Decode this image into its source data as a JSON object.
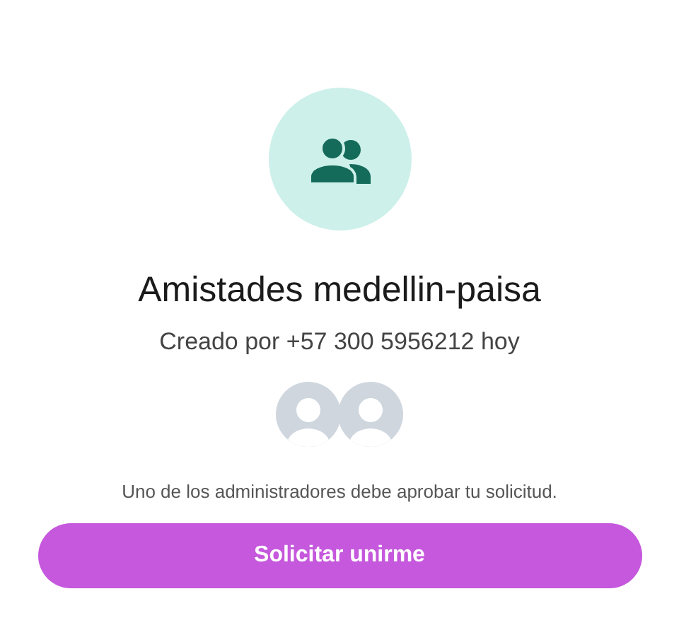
{
  "group": {
    "name": "Amistades medellin-paisa",
    "created": "Creado por +57 300 5956212 hoy"
  },
  "member_avatars": [
    {
      "kind": "placeholder"
    },
    {
      "kind": "placeholder"
    }
  ],
  "note": "Uno de los administradores debe aprobar tu solicitud.",
  "button": {
    "label": "Solicitar unirme"
  }
}
